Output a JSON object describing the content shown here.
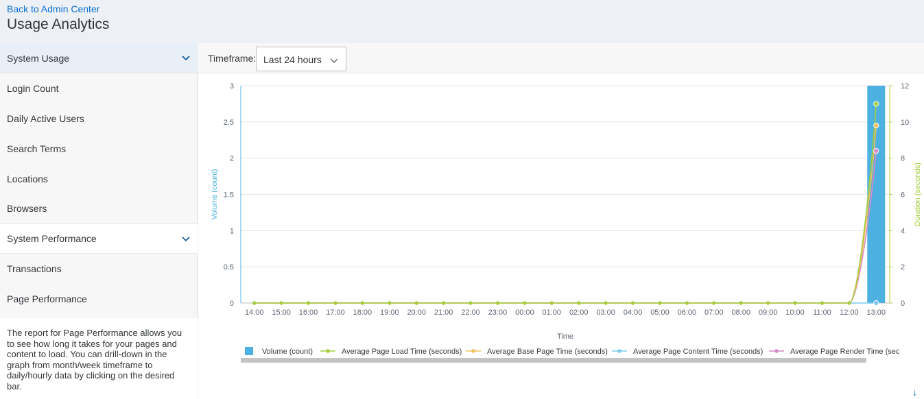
{
  "header": {
    "back_link": "Back to Admin Center",
    "title": "Usage Analytics"
  },
  "sidebar": {
    "system_usage": {
      "label": "System Usage",
      "items": [
        "Login Count",
        "Daily Active Users",
        "Search Terms",
        "Locations",
        "Browsers"
      ]
    },
    "system_performance": {
      "label": "System Performance",
      "items": [
        "Transactions",
        "Page Performance"
      ]
    },
    "description": "The report for Page Performance allows you to see how long it takes for your pages and content to load. You can drill-down in the graph from month/week timeframe to daily/hourly data by clicking on the desired bar."
  },
  "toolbar": {
    "timeframe_label": "Timeframe:",
    "timeframe_value": "Last 24 hours"
  },
  "chart_data": {
    "type": "bar",
    "xlabel": "Time",
    "ylabel": "Volume (count)",
    "y2label": "Duration (seconds)",
    "ylim": [
      0,
      3
    ],
    "y2lim": [
      0,
      12
    ],
    "yticks": [
      "0",
      "0.5",
      "1",
      "1.5",
      "2",
      "2.5",
      "3"
    ],
    "y2ticks": [
      "0",
      "2",
      "4",
      "6",
      "8",
      "10",
      "12"
    ],
    "categories": [
      "14:00",
      "15:00",
      "16:00",
      "17:00",
      "18:00",
      "19:00",
      "20:00",
      "21:00",
      "22:00",
      "23:00",
      "00:00",
      "01:00",
      "02:00",
      "03:00",
      "04:00",
      "05:00",
      "06:00",
      "07:00",
      "08:00",
      "09:00",
      "10:00",
      "11:00",
      "12:00",
      "13:00"
    ],
    "bars": {
      "name": "Volume (count)",
      "color": "#4cb1e0",
      "values": [
        0,
        0,
        0,
        0,
        0,
        0,
        0,
        0,
        0,
        0,
        0,
        0,
        0,
        0,
        0,
        0,
        0,
        0,
        0,
        0,
        0,
        0,
        0,
        3
      ]
    },
    "series": [
      {
        "name": "Average Page Load Time (seconds)",
        "color": "#a5cd3d",
        "values": [
          0,
          0,
          0,
          0,
          0,
          0,
          0,
          0,
          0,
          0,
          0,
          0,
          0,
          0,
          0,
          0,
          0,
          0,
          0,
          0,
          0,
          0,
          0,
          11
        ]
      },
      {
        "name": "Average Base Page Time (seconds)",
        "color": "#f0c05a",
        "values": [
          0,
          0,
          0,
          0,
          0,
          0,
          0,
          0,
          0,
          0,
          0,
          0,
          0,
          0,
          0,
          0,
          0,
          0,
          0,
          0,
          0,
          0,
          0,
          9.8
        ]
      },
      {
        "name": "Average Page Content Time (seconds)",
        "color": "#7dc8f0",
        "values": [
          0,
          0,
          0,
          0,
          0,
          0,
          0,
          0,
          0,
          0,
          0,
          0,
          0,
          0,
          0,
          0,
          0,
          0,
          0,
          0,
          0,
          0,
          0,
          0
        ]
      },
      {
        "name": "Average Page Render Time (sec",
        "color": "#d988c8",
        "values": [
          0,
          0,
          0,
          0,
          0,
          0,
          0,
          0,
          0,
          0,
          0,
          0,
          0,
          0,
          0,
          0,
          0,
          0,
          0,
          0,
          0,
          0,
          0,
          8.4
        ]
      }
    ],
    "legend": "bottom"
  }
}
